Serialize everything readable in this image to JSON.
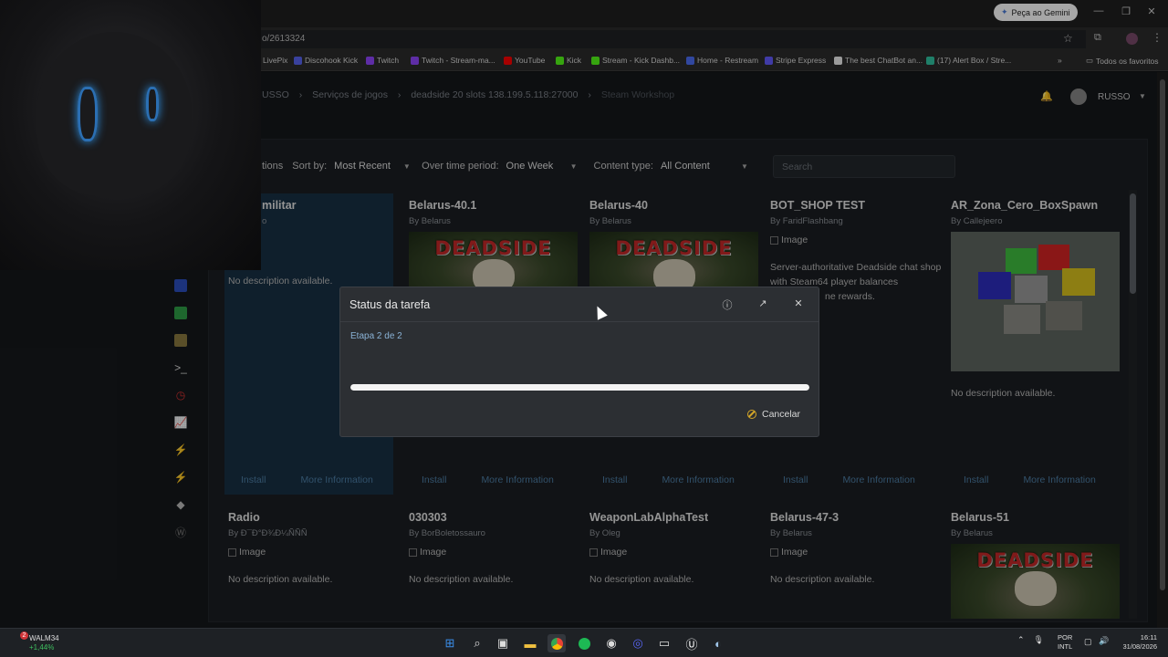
{
  "browser": {
    "gemini_label": "Peça ao Gemini",
    "url_fragment": "o/2613324",
    "bookmarks": [
      {
        "label": "LivePix",
        "color": "#2e8b57"
      },
      {
        "label": "Discohook Kick",
        "color": "#5865f2"
      },
      {
        "label": "Twitch",
        "color": "#9146ff"
      },
      {
        "label": "Twitch - Stream-ma...",
        "color": "#9146ff"
      },
      {
        "label": "YouTube",
        "color": "#ff0000"
      },
      {
        "label": "Kick",
        "color": "#53fc18"
      },
      {
        "label": "Stream - Kick Dashb...",
        "color": "#53fc18"
      },
      {
        "label": "Home - Restream",
        "color": "#4c6ef5"
      },
      {
        "label": "Stripe Express",
        "color": "#635bff"
      },
      {
        "label": "The best ChatBot an...",
        "color": "#eeeeee"
      },
      {
        "label": "(17) Alert Box / Stre...",
        "color": "#31c3a2"
      }
    ],
    "all_bookmarks_label": "Todos os favoritos"
  },
  "breadcrumb": [
    "USSO",
    "Serviços de jogos",
    "deadside 20 slots 138.199.5.118:27000",
    "Steam Workshop"
  ],
  "user": {
    "name": "RUSSO"
  },
  "filters": {
    "options_fragment": "tions",
    "sort_label": "Sort by:",
    "sort_value": "Most Recent",
    "period_label": "Over time period:",
    "period_value": "One Week",
    "content_label": "Content type:",
    "content_value": "All Content",
    "search_placeholder": "Search"
  },
  "cards": [
    {
      "title": "militar",
      "author": "o",
      "image": "",
      "description": "No description available.",
      "install": "Install",
      "more": "More Information"
    },
    {
      "title": "Belarus-40.1",
      "author": "By Belarus",
      "image": "deadside",
      "description": "",
      "install": "Install",
      "more": "More Information"
    },
    {
      "title": "Belarus-40",
      "author": "By Belarus",
      "image": "deadside",
      "description": "",
      "install": "Install",
      "more": "More Information"
    },
    {
      "title": "BOT_SHOP TEST",
      "author": "By FaridFlashbang",
      "image": "Image",
      "description": "Server-authoritative Deadside chat shop with Steam64 player balances",
      "description2": "ne rewards.",
      "install": "Install",
      "more": "More Information"
    },
    {
      "title": "AR_Zona_Cero_BoxSpawn",
      "author": "By Callejeero",
      "image": "boxes",
      "description": "No description available.",
      "install": "Install",
      "more": "More Information"
    },
    {
      "title": "Radio",
      "author": "By Ð¯Ð°Ð¾Ð¼ÑÑÑ",
      "image": "Image",
      "description": "No description available."
    },
    {
      "title": "030303",
      "author": "By BorBoletossauro",
      "image": "Image",
      "description": "No description available."
    },
    {
      "title": "WeaponLabAlphaTest",
      "author": "By Oleg",
      "image": "Image",
      "description": "No description available."
    },
    {
      "title": "Belarus-47-3",
      "author": "By Belarus",
      "image": "Image",
      "description": "No description available."
    },
    {
      "title": "Belarus-51",
      "author": "By Belarus",
      "image": "deadside",
      "description": ""
    }
  ],
  "deadside_logo": "DEADSIDE",
  "modal": {
    "title": "Status da tarefa",
    "step": "Etapa 2 de 2",
    "progress": 1.0,
    "cancel": "Cancelar"
  },
  "taskbar": {
    "stock_name": "WALM34",
    "stock_change": "+1,44%",
    "badge": "2",
    "lang1": "POR",
    "lang2": "INTL",
    "time": "16:11",
    "date": "31/08/2026"
  },
  "colors": {
    "accent": "#4d7ea6",
    "selected_card": "#173044",
    "progress": "#f4f4f4"
  }
}
